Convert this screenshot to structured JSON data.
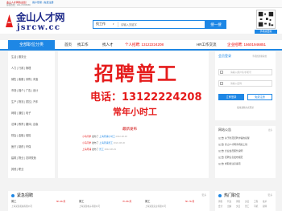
{
  "top_bar": {
    "welcome": "金山人才网欢迎您！",
    "login_links": "用户登录 | 免费注册",
    "hotline": "客服热线：021-37456666"
  },
  "header": {
    "logo_name": "金山人才网",
    "logo_domain": "jsrcw.cc",
    "search_category": "找工作",
    "search_placeholder": "请输入关键字",
    "search_button": "搜一搜",
    "qr_label": "手机版更新"
  },
  "nav": {
    "all_categories": "全部职位分类",
    "items": [
      {
        "label": "首页"
      },
      {
        "label": "找工作"
      },
      {
        "label": "找人才"
      },
      {
        "label": "个人招聘: 13122224208"
      },
      {
        "label": "HR工作交流"
      },
      {
        "label": "企业招聘: 15601946851"
      }
    ]
  },
  "sidebar": {
    "rows": [
      "生活 | 服务业",
      "人力 | 行政 | 管理",
      "销售 | 客服 | 采购 | 淘宝",
      "市场 | 媒介 | 广告 | 设计",
      "生产 | 物流 | 质控 | 汽车",
      "网络 | 通信 | 电子",
      "法律 | 教育 | 翻译 | 出版",
      "财会 | 金融 | 保险",
      "医疗 | 制药 | 环保",
      "建筑 | 物业 | 农林牧渔",
      "其他 | 职业"
    ]
  },
  "banner": {
    "line1": "招聘普工",
    "line2": "电话：13122224208",
    "line3": "常年小时工"
  },
  "login_panel": {
    "title": "会员登录",
    "subtitle": "手机找到新职位",
    "username_placeholder": "请输入用户名/手机号",
    "password_placeholder": "请输入密码",
    "login_button": "立即登录",
    "register_button": "免费注册",
    "other_login": "使用其他方式登录"
  },
  "latest": {
    "title": "最新发布",
    "rows": [
      {
        "who": "小马同学",
        "verb": "发布了",
        "job": "上海周浦小时工",
        "date": "2022-08-30"
      },
      {
        "who": "小马同学",
        "verb": "发布了",
        "job": "上海周浦普工",
        "date": "2022-08-30"
      },
      {
        "who": "上海周浦",
        "verb": "发布了",
        "job": "普工",
        "date": "2022-08-29"
      }
    ]
  },
  "notice": {
    "title": "网站公告",
    "more": "更多",
    "rows": [
      "[公告] 关于防范招聘诈骗的提醒",
      "[公告] 金山人才网手机版上线",
      "[公告] 企业会员服务说明",
      "[公告] 招聘信息发布规范",
      "[公告] 求职者注意事项"
    ]
  },
  "section_left": {
    "title": "紧急招聘",
    "more": "更多",
    "cells": [
      {
        "job": "普工",
        "pay": "6K-9K/月",
        "company": "上海某某机械有限公司"
      },
      {
        "job": "普工",
        "pay": "7K-8K/月",
        "company": "上海某某电子有限公司"
      },
      {
        "job": "普工",
        "pay": "5K-7K/月",
        "company": "上海某某实业有限公司"
      }
    ]
  },
  "section_right": {
    "title": "热门职位",
    "more": "更多",
    "rows": [
      [
        "销售",
        "代表",
        "销售",
        "文员",
        "工程",
        "技术"
      ],
      [
        "会计",
        "出纳",
        "文员",
        "普工",
        "司机",
        "厨师"
      ]
    ]
  }
}
